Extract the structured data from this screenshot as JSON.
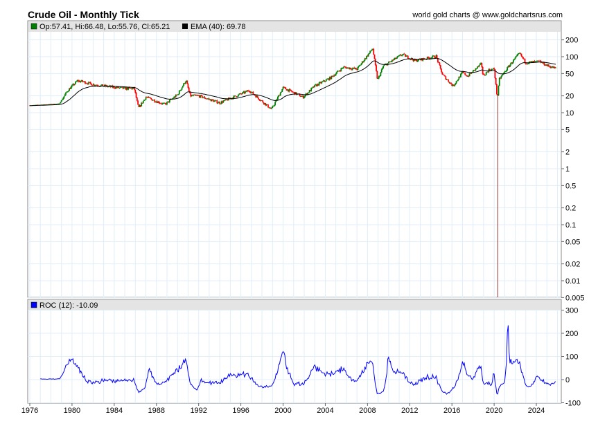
{
  "header": {
    "title": "Crude Oil - Monthly Tick",
    "credit": "world gold charts @ www.goldchartsrus.com"
  },
  "legend": {
    "ohlc": "Op:57.41, Hi:66.48, Lo:55.76, Cl:65.21",
    "ohlc_color": "#008000",
    "ema": "EMA (40): 69.78",
    "ema_color": "#000000",
    "roc": "ROC (12): -10.09",
    "roc_color": "#0000ff"
  },
  "colors": {
    "up": "#008000",
    "down": "#ff0000",
    "roc": "#0000ff",
    "grid": "#e0eef8"
  },
  "chart_data": {
    "type": "candlestick+line",
    "title": "Crude Oil - Monthly Tick",
    "price_axis": {
      "scale": "log",
      "ticks": [
        "200",
        "100",
        "50",
        "20",
        "10",
        "5",
        "2",
        "1",
        "0.5",
        "0.2",
        "0.1",
        "0.05",
        "0.02",
        "0.01",
        "0.005"
      ]
    },
    "roc_axis": {
      "ticks": [
        "300",
        "200",
        "100",
        "0",
        "-100"
      ],
      "range": [
        -100,
        300
      ]
    },
    "x_ticks": [
      "1976",
      "1980",
      "1984",
      "1988",
      "1992",
      "1996",
      "2000",
      "2004",
      "2008",
      "2012",
      "2016",
      "2020",
      "2024"
    ],
    "xlim": [
      1975.8,
      2026.3
    ],
    "close_anchors": [
      [
        1976,
        13.5
      ],
      [
        1978.8,
        14.5
      ],
      [
        1979.6,
        25
      ],
      [
        1980.5,
        37
      ],
      [
        1981,
        36
      ],
      [
        1982,
        32
      ],
      [
        1983,
        30
      ],
      [
        1985,
        27
      ],
      [
        1985.9,
        27
      ],
      [
        1986.3,
        12
      ],
      [
        1987,
        19
      ],
      [
        1988.8,
        14
      ],
      [
        1990,
        21
      ],
      [
        1990.8,
        38
      ],
      [
        1991.2,
        20
      ],
      [
        1992,
        20
      ],
      [
        1994,
        15
      ],
      [
        1995,
        18
      ],
      [
        1996.8,
        25
      ],
      [
        1998.9,
        11.5
      ],
      [
        2000,
        28
      ],
      [
        2001.9,
        19
      ],
      [
        2003,
        30
      ],
      [
        2004.5,
        42
      ],
      [
        2005.7,
        65
      ],
      [
        2007,
        60
      ],
      [
        2008.5,
        140
      ],
      [
        2008.95,
        38
      ],
      [
        2009.5,
        68
      ],
      [
        2011.3,
        110
      ],
      [
        2012.5,
        85
      ],
      [
        2014.5,
        102
      ],
      [
        2015.1,
        48
      ],
      [
        2016.1,
        30
      ],
      [
        2017,
        52
      ],
      [
        2017.5,
        45
      ],
      [
        2018.8,
        75
      ],
      [
        2018.95,
        45
      ],
      [
        2019.5,
        58
      ],
      [
        2020.0,
        60
      ],
      [
        2020.3,
        18
      ],
      [
        2020.5,
        40
      ],
      [
        2021.5,
        72
      ],
      [
        2022.4,
        115
      ],
      [
        2023,
        78
      ],
      [
        2024.3,
        82
      ],
      [
        2025,
        70
      ],
      [
        2025.8,
        62
      ]
    ],
    "min_spike": {
      "year": 2020.3,
      "value": -37
    },
    "last_ohlc": {
      "open": 57.41,
      "high": 66.48,
      "low": 55.76,
      "close": 65.21
    },
    "ema_period": 40,
    "roc_period": 12
  }
}
